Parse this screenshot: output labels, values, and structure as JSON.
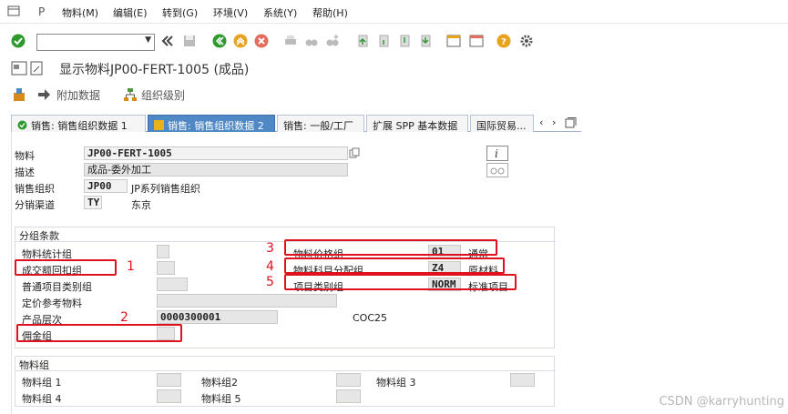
{
  "menu": {
    "items": [
      "物料(M)",
      "编辑(E)",
      "转到(G)",
      "环境(V)",
      "系统(Y)",
      "帮助(H)"
    ]
  },
  "title": "显示物料JP00-FERT-1005 (成品)",
  "app_toolbar": {
    "additional_data": "附加数据",
    "org_levels": "组织级别"
  },
  "tabs": [
    "销售: 销售组织数据 1",
    "销售: 销售组织数据 2",
    "销售: 一般/工厂",
    "扩展 SPP 基本数据",
    "国际贸易..."
  ],
  "header": {
    "material_label": "物料",
    "material_value": "JP00-FERT-1005",
    "desc_label": "描述",
    "desc_value": "成品-委外加工",
    "sales_org_label": "销售组织",
    "sales_org_value": "JP00",
    "sales_org_text": "JP系列销售组织",
    "dist_channel_label": "分销渠道",
    "dist_channel_value": "TY",
    "dist_channel_text": "东京"
  },
  "grouping": {
    "title": "分组条款",
    "mat_stat_group": "物料统计组",
    "volume_rebate_group": "成交额回扣组",
    "gen_item_cat_group": "普通项目类别组",
    "pricing_ref_material": "定价参考物料",
    "product_hierarchy_label": "产品层次",
    "product_hierarchy_value": "0000300001",
    "product_hierarchy_text": "COC25",
    "commission_group": "佣金组",
    "mat_price_group_label": "物料价格组",
    "mat_price_group_value": "01",
    "mat_price_group_text": "通常",
    "acct_assign_group_label": "物料科目分配组",
    "acct_assign_group_value": "Z4",
    "acct_assign_group_text": "原材料",
    "item_cat_group_label": "项目类别组",
    "item_cat_group_value": "NORM",
    "item_cat_group_text": "标准项目"
  },
  "material_groups": {
    "title": "物料组",
    "g1": "物料组 1",
    "g2": "物料组2",
    "g3": "物料组 3",
    "g4": "物料组 4",
    "g5": "物料组 5"
  },
  "annotations": [
    "1",
    "2",
    "3",
    "4",
    "5"
  ],
  "watermark": "CSDN @karryhunting",
  "colors": {
    "accent": "#4f88c5",
    "annotation": "#e0111c"
  }
}
